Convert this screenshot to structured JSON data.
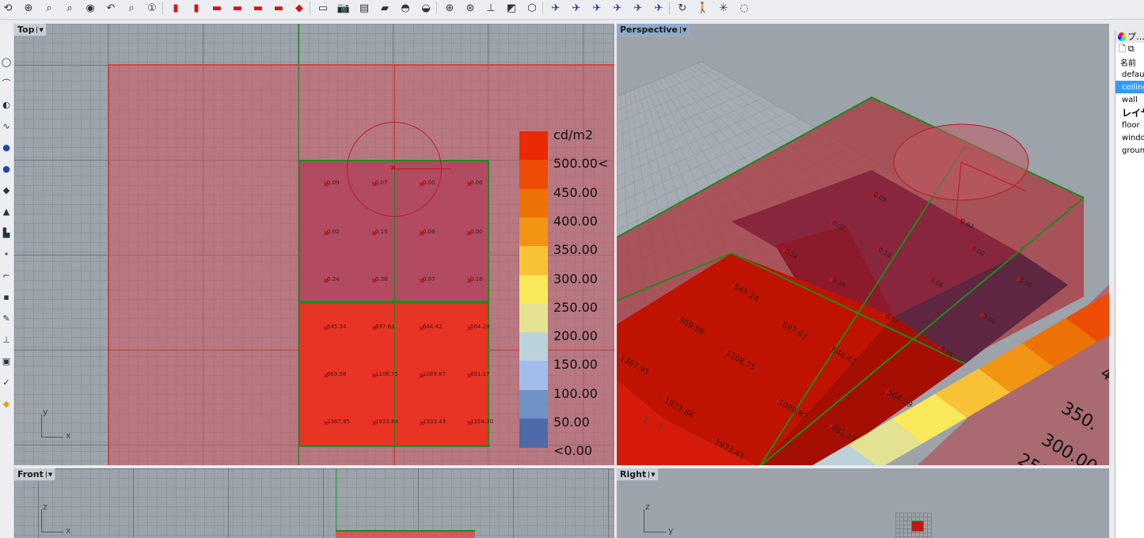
{
  "toolbar": {
    "items": [
      {
        "icon": "rotate-view-icon",
        "glyph": "⟲"
      },
      {
        "icon": "zoom-in-out-icon",
        "glyph": "⊕"
      },
      {
        "icon": "zoom-extents-icon",
        "glyph": "⌕"
      },
      {
        "icon": "zoom-window-icon",
        "glyph": "⌕"
      },
      {
        "icon": "zoom-selected-icon",
        "glyph": "◉"
      },
      {
        "icon": "undo-view-icon",
        "glyph": "↶"
      },
      {
        "icon": "zoom-target-icon",
        "glyph": "⌕"
      },
      {
        "icon": "zoom-1to1-icon",
        "glyph": "①"
      },
      {
        "icon": "car-top-view-icon",
        "glyph": "▮"
      },
      {
        "icon": "car-bottom-view-icon",
        "glyph": "▮"
      },
      {
        "icon": "car-front-view-icon",
        "glyph": "▬"
      },
      {
        "icon": "car-left-view-icon",
        "glyph": "▬"
      },
      {
        "icon": "car-right-view-icon",
        "glyph": "▬"
      },
      {
        "icon": "car-back-view-icon",
        "glyph": "▬"
      },
      {
        "icon": "car-perspective-view-icon",
        "glyph": "◆"
      },
      {
        "icon": "named-view-icon",
        "glyph": "▭"
      },
      {
        "icon": "camera-icon",
        "glyph": "📷"
      },
      {
        "icon": "save-view-icon",
        "glyph": "▤"
      },
      {
        "icon": "open-folder-icon",
        "glyph": "▰"
      },
      {
        "icon": "light-icon",
        "glyph": "◓"
      },
      {
        "icon": "spotlight-icon",
        "glyph": "◒"
      },
      {
        "icon": "target-cplane-icon",
        "glyph": "⊕"
      },
      {
        "icon": "cplane-origin-icon",
        "glyph": "⊛"
      },
      {
        "icon": "cplane-axis-icon",
        "glyph": "⊥"
      },
      {
        "icon": "cplane-object-icon",
        "glyph": "◩"
      },
      {
        "icon": "cplane-cube-icon",
        "glyph": "⬡"
      },
      {
        "icon": "plane-top-icon",
        "glyph": "✈"
      },
      {
        "icon": "plane-front-icon",
        "glyph": "✈"
      },
      {
        "icon": "plane-right-icon",
        "glyph": "✈"
      },
      {
        "icon": "plane-left-icon",
        "glyph": "✈"
      },
      {
        "icon": "plane-side-icon",
        "glyph": "✈"
      },
      {
        "icon": "plane-back-icon",
        "glyph": "✈"
      },
      {
        "icon": "rotate-camera-icon",
        "glyph": "↻"
      },
      {
        "icon": "walkabout-icon",
        "glyph": "🚶"
      },
      {
        "icon": "sun-light-icon",
        "glyph": "✳"
      },
      {
        "icon": "target-circle-icon",
        "glyph": "◌"
      }
    ]
  },
  "viewports": {
    "top": {
      "label": "Top",
      "axis_a": "y",
      "axis_b": "x"
    },
    "perspective": {
      "label": "Perspective",
      "axis_a": "z",
      "axis_b": "y"
    },
    "front": {
      "label": "Front",
      "axis_a": "z",
      "axis_b": "x"
    },
    "right": {
      "label": "Right",
      "axis_a": "z",
      "axis_b": "y"
    }
  },
  "legend": {
    "unit": "cd/m2",
    "colors": [
      "#ea2a04",
      "#ec4c05",
      "#ec7205",
      "#f19414",
      "#f8c236",
      "#fae95a",
      "#e3e292",
      "#bbd2db",
      "#a2bdeb",
      "#7092c6",
      "#4e6aa9"
    ],
    "labels": [
      "500.00<",
      "450.00",
      "400.00",
      "350.00",
      "300.00",
      "250.00",
      "200.00",
      "150.00",
      "100.00",
      "50.00",
      "<0.00"
    ]
  },
  "top_view": {
    "upper_room_values": [
      [
        "0.09",
        "0.07",
        "0.00",
        "0.00"
      ],
      [
        "0.02",
        "0.10",
        "0.06",
        "0.00"
      ],
      [
        "0.24",
        "0.38",
        "0.07",
        "0.18"
      ]
    ],
    "lower_room_values": [
      [
        "545.24",
        "697.63",
        "644.42",
        "564.29"
      ],
      [
        "969.98",
        "1108.75",
        "1089.87",
        "891.17"
      ],
      [
        "1367.95",
        "1923.84",
        "1933.43",
        "1354.30"
      ]
    ]
  },
  "perspective_view": {
    "labels": [
      {
        "text": "0.09"
      },
      {
        "text": "0.07"
      },
      {
        "text": "0.00"
      },
      {
        "text": "0.02"
      },
      {
        "text": "0.10"
      },
      {
        "text": "0.06"
      },
      {
        "text": "0.00"
      },
      {
        "text": "0.24"
      },
      {
        "text": "0.38"
      },
      {
        "text": "0.07"
      },
      {
        "text": "0.00"
      },
      {
        "text": "0.18"
      },
      {
        "text": "545.24"
      },
      {
        "text": "697.63"
      },
      {
        "text": "969.98"
      },
      {
        "text": "1108.75"
      },
      {
        "text": "644.42"
      },
      {
        "text": "1367.95"
      },
      {
        "text": "1089.87"
      },
      {
        "text": "564.29"
      },
      {
        "text": "1923.84"
      },
      {
        "text": "891.17"
      },
      {
        "text": "1933.43"
      }
    ],
    "legend_labels": [
      "4",
      "350.",
      "300.00",
      "250"
    ]
  },
  "layer_panel": {
    "title": "プ…",
    "header": "名前",
    "rows": [
      {
        "label": "default",
        "selected": false,
        "bold": false
      },
      {
        "label": "ceiling",
        "selected": true,
        "bold": false
      },
      {
        "label": "wall",
        "selected": false,
        "bold": false
      },
      {
        "label": "レイヤ",
        "selected": false,
        "bold": true
      },
      {
        "label": "floor",
        "selected": false,
        "bold": false
      },
      {
        "label": "window",
        "selected": false,
        "bold": false
      },
      {
        "label": "ground",
        "selected": false,
        "bold": false
      }
    ]
  }
}
